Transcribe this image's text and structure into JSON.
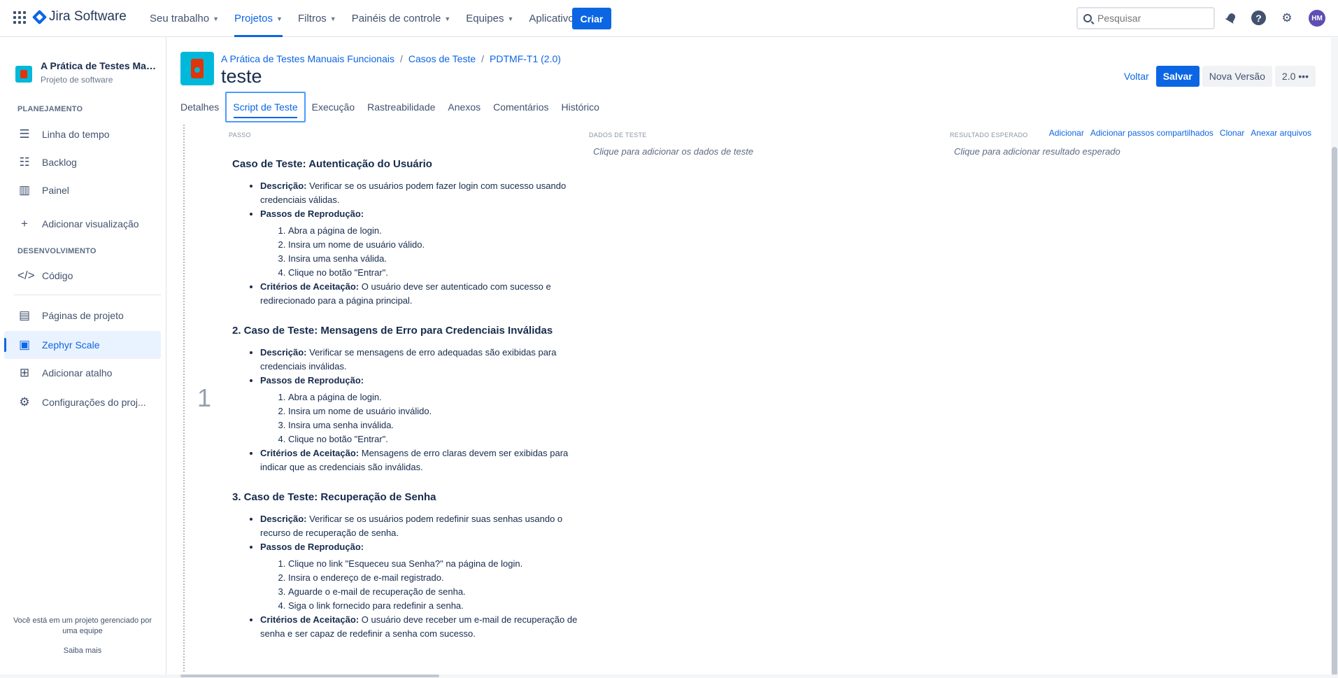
{
  "topbar": {
    "app_name": "Jira Software",
    "nav": [
      {
        "label": "Seu trabalho"
      },
      {
        "label": "Projetos"
      },
      {
        "label": "Filtros"
      },
      {
        "label": "Painéis de controle"
      },
      {
        "label": "Equipes"
      },
      {
        "label": "Aplicativos"
      }
    ],
    "create_label": "Criar",
    "search_placeholder": "Pesquisar",
    "avatar_initials": "HM",
    "accent_color": "#0c66e4"
  },
  "sidebar": {
    "project_name": "A Prática de Testes Man...",
    "project_type": "Projeto de software",
    "section_planning": "PLANEJAMENTO",
    "section_dev": "DESENVOLVIMENTO",
    "items": [
      {
        "label": "Linha do tempo",
        "icon": "timeline-icon"
      },
      {
        "label": "Backlog",
        "icon": "backlog-icon"
      },
      {
        "label": "Painel",
        "icon": "board-icon"
      },
      {
        "label": "Adicionar visualização",
        "icon": "plus-icon"
      },
      {
        "label": "Código",
        "icon": "code-icon"
      },
      {
        "label": "Páginas de projeto",
        "icon": "page-icon"
      },
      {
        "label": "Zephyr Scale",
        "icon": "zephyr-icon"
      },
      {
        "label": "Adicionar atalho",
        "icon": "add-shortcut-icon"
      },
      {
        "label": "Configurações do proj...",
        "icon": "gear-icon"
      }
    ],
    "footer_text": "Você está em um projeto gerenciado por uma equipe",
    "footer_link": "Saiba mais"
  },
  "header": {
    "breadcrumbs": [
      "A Prática de Testes Manuais Funcionais",
      "Casos de Teste",
      "PDTMF-T1 (2.0)"
    ],
    "title": "teste",
    "back_label": "Voltar",
    "save_label": "Salvar",
    "new_version_label": "Nova Versão",
    "version_label": "2.0",
    "more_label": "•••"
  },
  "tabs": [
    {
      "label": "Detalhes"
    },
    {
      "label": "Script de Teste"
    },
    {
      "label": "Execução"
    },
    {
      "label": "Rastreabilidade"
    },
    {
      "label": "Anexos"
    },
    {
      "label": "Comentários"
    },
    {
      "label": "Histórico"
    }
  ],
  "script": {
    "col_step": "PASSO",
    "col_data": "DADOS DE TESTE",
    "col_expected": "RESULTADO ESPERADO",
    "data_placeholder": "Clique para adicionar os dados de teste",
    "expected_placeholder": "Clique para adicionar resultado esperado",
    "actions": [
      "Adicionar",
      "Adicionar passos compartilhados",
      "Clonar",
      "Anexar arquivos"
    ],
    "step_number": "1",
    "cases": [
      {
        "title": "Caso de Teste: Autenticação do Usuário",
        "desc_label": "Descrição:",
        "desc": "Verificar se os usuários podem fazer login com sucesso usando credenciais válidas.",
        "steps_label": "Passos de Reprodução:",
        "steps": [
          "Abra a página de login.",
          "Insira um nome de usuário válido.",
          "Insira uma senha válida.",
          "Clique no botão \"Entrar\"."
        ],
        "criteria_label": "Critérios de Aceitação:",
        "criteria": "O usuário deve ser autenticado com sucesso e redirecionado para a página principal."
      },
      {
        "title": "2. Caso de Teste: Mensagens de Erro para Credenciais Inválidas",
        "desc_label": "Descrição:",
        "desc": "Verificar se mensagens de erro adequadas são exibidas para credenciais inválidas.",
        "steps_label": "Passos de Reprodução:",
        "steps": [
          "Abra a página de login.",
          "Insira um nome de usuário inválido.",
          "Insira uma senha inválida.",
          "Clique no botão \"Entrar\"."
        ],
        "criteria_label": "Critérios de Aceitação:",
        "criteria": "Mensagens de erro claras devem ser exibidas para indicar que as credenciais são inválidas."
      },
      {
        "title": "3. Caso de Teste: Recuperação de Senha",
        "desc_label": "Descrição:",
        "desc": "Verificar se os usuários podem redefinir suas senhas usando o recurso de recuperação de senha.",
        "steps_label": "Passos de Reprodução:",
        "steps": [
          "Clique no link \"Esqueceu sua Senha?\" na página de login.",
          "Insira o endereço de e-mail registrado.",
          "Aguarde o e-mail de recuperação de senha.",
          "Siga o link fornecido para redefinir a senha."
        ],
        "criteria_label": "Critérios de Aceitação:",
        "criteria": "O usuário deve receber um e-mail de recuperação de senha e ser capaz de redefinir a senha com sucesso."
      }
    ]
  }
}
